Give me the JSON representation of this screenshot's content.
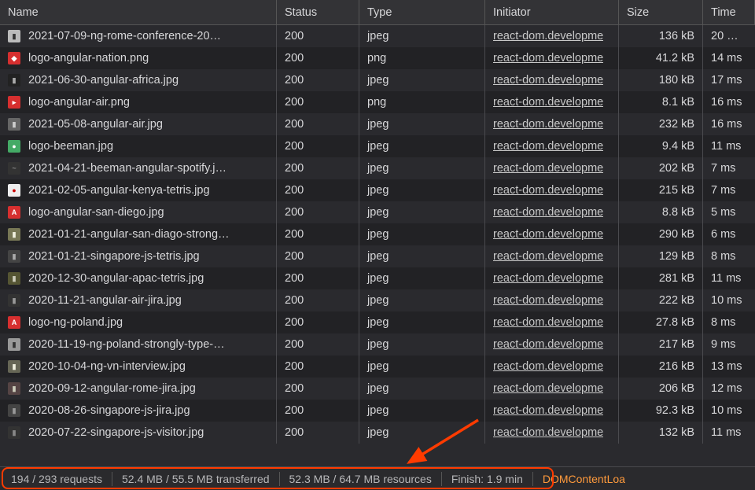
{
  "columns": {
    "name": "Name",
    "status": "Status",
    "type": "Type",
    "initiator": "Initiator",
    "size": "Size",
    "time": "Time"
  },
  "initiator_text": "react-dom.developme",
  "rows": [
    {
      "icon_bg": "#bbb",
      "icon_fg": "#333",
      "icon_txt": "▮",
      "name": "2021-07-09-ng-rome-conference-20…",
      "status": "200",
      "type": "jpeg",
      "size": "136 kB",
      "time": "20 …"
    },
    {
      "icon_bg": "#d62f2f",
      "icon_fg": "#fff",
      "icon_txt": "◆",
      "name": "logo-angular-nation.png",
      "status": "200",
      "type": "png",
      "size": "41.2 kB",
      "time": "14 ms"
    },
    {
      "icon_bg": "#222",
      "icon_fg": "#aaa",
      "icon_txt": "▮",
      "name": "2021-06-30-angular-africa.jpg",
      "status": "200",
      "type": "jpeg",
      "size": "180 kB",
      "time": "17 ms"
    },
    {
      "icon_bg": "#d62f2f",
      "icon_fg": "#fff",
      "icon_txt": "▸",
      "name": "logo-angular-air.png",
      "status": "200",
      "type": "png",
      "size": "8.1 kB",
      "time": "16 ms"
    },
    {
      "icon_bg": "#666",
      "icon_fg": "#ccc",
      "icon_txt": "▮",
      "name": "2021-05-08-angular-air.jpg",
      "status": "200",
      "type": "jpeg",
      "size": "232 kB",
      "time": "16 ms"
    },
    {
      "icon_bg": "#4a6",
      "icon_fg": "#fff",
      "icon_txt": "●",
      "name": "logo-beeman.jpg",
      "status": "200",
      "type": "jpeg",
      "size": "9.4 kB",
      "time": "11 ms"
    },
    {
      "icon_bg": "#333",
      "icon_fg": "#888",
      "icon_txt": "~",
      "name": "2021-04-21-beeman-angular-spotify.j…",
      "status": "200",
      "type": "jpeg",
      "size": "202 kB",
      "time": "7 ms"
    },
    {
      "icon_bg": "#eee",
      "icon_fg": "#c00",
      "icon_txt": "●",
      "name": "2021-02-05-angular-kenya-tetris.jpg",
      "status": "200",
      "type": "jpeg",
      "size": "215 kB",
      "time": "7 ms"
    },
    {
      "icon_bg": "#d62f2f",
      "icon_fg": "#fff",
      "icon_txt": "A",
      "name": "logo-angular-san-diego.jpg",
      "status": "200",
      "type": "jpeg",
      "size": "8.8 kB",
      "time": "5 ms"
    },
    {
      "icon_bg": "#775",
      "icon_fg": "#eed",
      "icon_txt": "▮",
      "name": "2021-01-21-angular-san-diago-strong…",
      "status": "200",
      "type": "jpeg",
      "size": "290 kB",
      "time": "6 ms"
    },
    {
      "icon_bg": "#444",
      "icon_fg": "#aaa",
      "icon_txt": "▮",
      "name": "2021-01-21-singapore-js-tetris.jpg",
      "status": "200",
      "type": "jpeg",
      "size": "129 kB",
      "time": "8 ms"
    },
    {
      "icon_bg": "#553",
      "icon_fg": "#ccb",
      "icon_txt": "▮",
      "name": "2020-12-30-angular-apac-tetris.jpg",
      "status": "200",
      "type": "jpeg",
      "size": "281 kB",
      "time": "11 ms"
    },
    {
      "icon_bg": "#333",
      "icon_fg": "#999",
      "icon_txt": "▮",
      "name": "2020-11-21-angular-air-jira.jpg",
      "status": "200",
      "type": "jpeg",
      "size": "222 kB",
      "time": "10 ms"
    },
    {
      "icon_bg": "#d62f2f",
      "icon_fg": "#fff",
      "icon_txt": "A",
      "name": "logo-ng-poland.jpg",
      "status": "200",
      "type": "jpeg",
      "size": "27.8 kB",
      "time": "8 ms"
    },
    {
      "icon_bg": "#999",
      "icon_fg": "#333",
      "icon_txt": "▮",
      "name": "2020-11-19-ng-poland-strongly-type-…",
      "status": "200",
      "type": "jpeg",
      "size": "217 kB",
      "time": "9 ms"
    },
    {
      "icon_bg": "#665",
      "icon_fg": "#eed",
      "icon_txt": "▮",
      "name": "2020-10-04-ng-vn-interview.jpg",
      "status": "200",
      "type": "jpeg",
      "size": "216 kB",
      "time": "13 ms"
    },
    {
      "icon_bg": "#544",
      "icon_fg": "#ccb",
      "icon_txt": "▮",
      "name": "2020-09-12-angular-rome-jira.jpg",
      "status": "200",
      "type": "jpeg",
      "size": "206 kB",
      "time": "12 ms"
    },
    {
      "icon_bg": "#444",
      "icon_fg": "#999",
      "icon_txt": "▮",
      "name": "2020-08-26-singapore-js-jira.jpg",
      "status": "200",
      "type": "jpeg",
      "size": "92.3 kB",
      "time": "10 ms"
    },
    {
      "icon_bg": "#333",
      "icon_fg": "#888",
      "icon_txt": "▮",
      "name": "2020-07-22-singapore-js-visitor.jpg",
      "status": "200",
      "type": "jpeg",
      "size": "132 kB",
      "time": "11 ms"
    }
  ],
  "statusbar": {
    "requests": "194 / 293 requests",
    "transferred": "52.4 MB / 55.5 MB transferred",
    "resources": "52.3 MB / 64.7 MB resources",
    "finish": "Finish: 1.9 min",
    "dom": "DOMContentLoa"
  }
}
